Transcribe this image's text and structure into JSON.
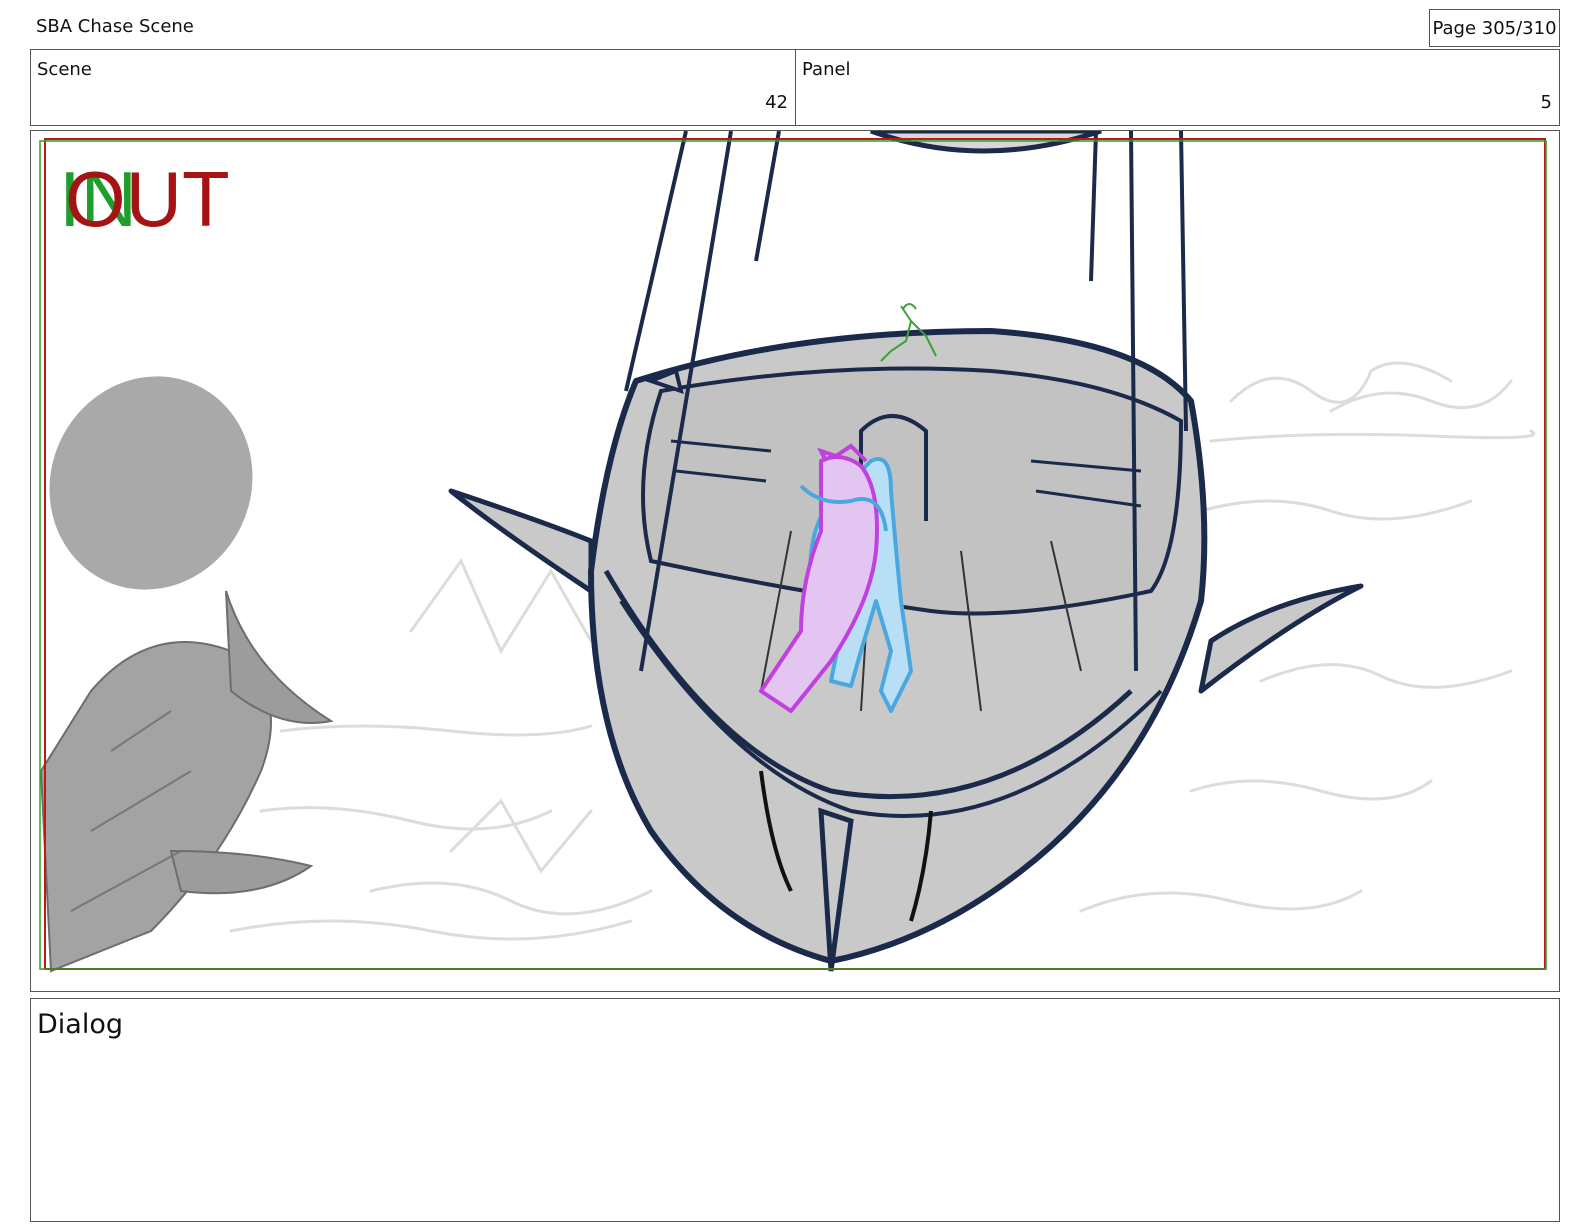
{
  "header": {
    "title": "SBA Chase Scene",
    "page": "Page 305/310"
  },
  "info": {
    "scene_label": "Scene",
    "scene_value": "42",
    "panel_label": "Panel",
    "panel_value": "5"
  },
  "panel": {
    "in_marker": "IN",
    "out_marker": "OUT",
    "colors": {
      "in_green": "#1e9e2a",
      "out_red": "#a51414",
      "ship_fill": "#c9c9c9",
      "ink": "#1b2a4a",
      "character_magenta": "#c040e0",
      "character_blue": "#4aa8e0"
    }
  },
  "dialog": {
    "label": "Dialog",
    "text": ""
  }
}
